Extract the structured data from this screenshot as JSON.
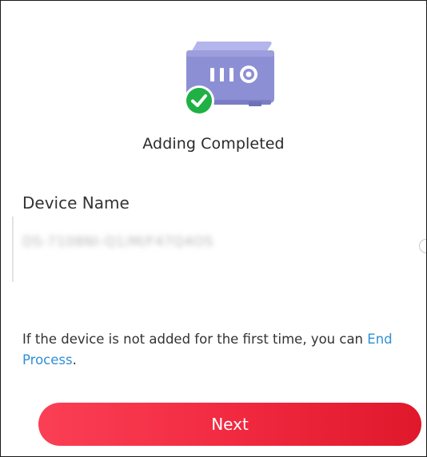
{
  "status": {
    "title": "Adding Completed",
    "icon": "success-check-icon",
    "check_color": "#1fb144"
  },
  "device": {
    "illustration_icon": "nvr-device-icon",
    "body_color": "#8d8fd4",
    "name_label": "Device Name",
    "name_value": "DS-7108NI-Q1/M/F47Q4OS"
  },
  "hint": {
    "text": "If the device is not added for the first time, you can ",
    "link_word_1": "End",
    "link_word_2": "Process",
    "suffix": "."
  },
  "actions": {
    "next_label": "Next",
    "accent_color": "#f0283f"
  },
  "link_color": "#2f8fd8"
}
